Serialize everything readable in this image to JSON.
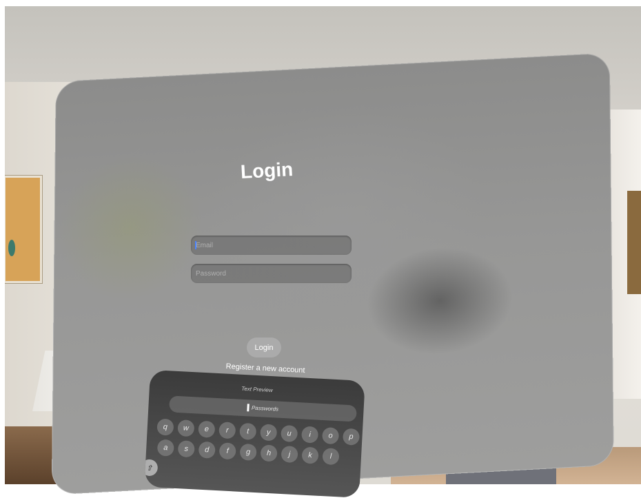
{
  "window": {
    "title": "Login"
  },
  "form": {
    "email_placeholder": "Email",
    "password_placeholder": "Password",
    "login_label": "Login",
    "register_label": "Register a new account"
  },
  "keyboard": {
    "preview_label": "Text Preview",
    "suggestion_label": "Passwords",
    "row1": [
      "q",
      "w",
      "e",
      "r",
      "t",
      "y",
      "u",
      "i",
      "o",
      "p"
    ],
    "row2": [
      "a",
      "s",
      "d",
      "f",
      "g",
      "h",
      "j",
      "k",
      "l"
    ],
    "shift_icon": "shift-icon"
  }
}
